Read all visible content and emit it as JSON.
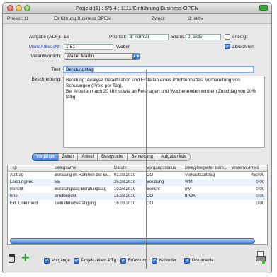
{
  "window": {
    "title": "Projekt (1) : 5/5.4 : 1111/Einführung Business OPEN"
  },
  "header": {
    "projekt_label": "Projekt: 11",
    "projekt_name": "Einführung Business OPEN",
    "zweck_label": "Zweck",
    "status_label": "2: aktiv"
  },
  "form": {
    "aufgabe_label": "Aufgabe (AUF):",
    "aufgabe_value": "15",
    "prioritaet_label": "Priorität:",
    "prioritaet_value": "3: normal",
    "status_label": "Status:",
    "status_value": "2: aktiv",
    "erledigt_label": "erledigt",
    "mandadress_label": "MandAdressNr:",
    "mandadress_value": "1-51",
    "mandadress_name": "Weber",
    "abrechnen_label": "abrechnen",
    "verantwortlich_label": "Verantwortlich:",
    "verantwortlich_value": "Walter Martin",
    "titel_label": "Titel:",
    "titel_value": "Beratungstag",
    "beschreibung_label": "Beschreibung:",
    "beschreibung_value": "Beratung: Analyse Detailfiliation und Erstellen eines Pflichtenheftes. Vorbereitung von Schulungen (Preis per Tag).\nBei Arbeiten nach 20 Uhr sowie an Feiertagen und Wochenenden wird ein Zuschlag von 20% fällig."
  },
  "tabs": [
    {
      "label": "Vorgänge",
      "active": true
    },
    {
      "label": "Zeiten",
      "active": false
    },
    {
      "label": "Artikel",
      "active": false
    },
    {
      "label": "Belegsuche",
      "active": false
    },
    {
      "label": "Bemerkung",
      "active": false
    },
    {
      "label": "Aufgabenliste",
      "active": false
    }
  ],
  "table": {
    "columns": [
      "Typ",
      "Belegname",
      "Datum",
      "Vorgangsstatus",
      "Beleg/Begleiter Bem...",
      "Warenw./Preis"
    ],
    "rows": [
      [
        "Auftrag",
        "Beratung im Rahmen der Ei...",
        "01.03.2010",
        "CO",
        "Verkaufsauftrag",
        "450,00"
      ],
      [
        "LeistungPos",
        "SE",
        "25.03.2010",
        "Beratung",
        "WM",
        "0,00"
      ],
      [
        "Bericht",
        "Beratungstag Beratungstag",
        "10.03.2010",
        "Bericht",
        "nw",
        "0,00"
      ],
      [
        "Brief",
        "Briefbericht",
        "15.03.2010",
        "CO",
        "tPWA",
        "0,00"
      ],
      [
        "Ext. Dokument",
        "Teilnahmebestätigung",
        "16.03.2010",
        "CO",
        "",
        "0,00"
      ]
    ]
  },
  "bottombar": {
    "options": [
      {
        "label": "Vorgänge",
        "checked": true
      },
      {
        "label": "Projektzeiten & Tg",
        "checked": true
      },
      {
        "label": "Erfassung",
        "checked": true
      },
      {
        "label": "Kalender",
        "checked": true
      },
      {
        "label": "Dokumente",
        "checked": true
      }
    ]
  }
}
